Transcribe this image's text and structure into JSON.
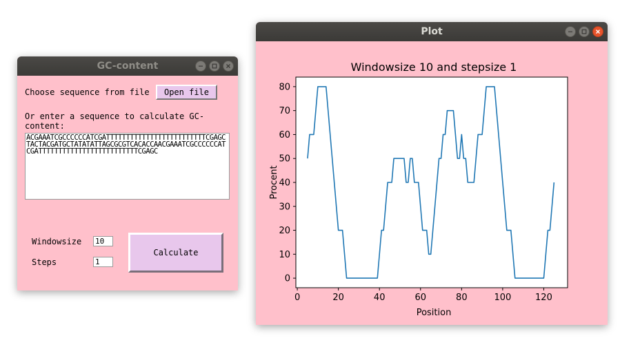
{
  "gc_window": {
    "title": "GC-content",
    "choose_label": "Choose sequence from file",
    "open_button": "Open file",
    "enter_label": "Or enter a sequence to calculate GC-content:",
    "sequence": "ACGAAATCGCCCCCCATCGATTTTTTTTTTTTTTTTTTTTTTTTTCGAGCTACTACGATGCTATATATTAGCGCGTCACACCAACGAAATCGCCCCCCATCGATTTTTTTTTTTTTTTTTTTTTTTTTCGAGC",
    "windowsize_label": "Windowsize",
    "windowsize_value": "10",
    "steps_label": "Steps",
    "steps_value": "1",
    "calculate_button": "Calculate"
  },
  "plot_window": {
    "title": "Plot"
  },
  "colors": {
    "pink_bg": "#ffc0cb",
    "button_bg": "#e8c7ec",
    "line": "#1f77b4"
  },
  "chart_data": {
    "type": "line",
    "title": "Windowsize 10 and stepsize 1",
    "xlabel": "Position",
    "ylabel": "Procent",
    "xlim": [
      -0.7,
      131.6
    ],
    "ylim": [
      -4,
      84
    ],
    "xticks": [
      0,
      20,
      40,
      60,
      80,
      100,
      120
    ],
    "yticks": [
      0,
      10,
      20,
      30,
      40,
      50,
      60,
      70,
      80
    ],
    "grid": false,
    "series": [
      {
        "x": [
          5,
          6,
          7,
          8,
          9,
          10,
          11,
          12,
          13,
          14,
          15,
          16,
          17,
          18,
          19,
          20,
          21,
          22,
          23,
          24,
          25,
          26,
          27,
          28,
          29,
          30,
          31,
          32,
          33,
          34,
          35,
          36,
          37,
          38,
          39,
          40,
          41,
          42,
          43,
          44,
          45,
          46,
          47,
          48,
          49,
          50,
          51,
          52,
          53,
          54,
          55,
          56,
          57,
          58,
          59,
          60,
          61,
          62,
          63,
          64,
          65,
          66,
          67,
          68,
          69,
          70,
          71,
          72,
          73,
          74,
          75,
          76,
          77,
          78,
          79,
          80,
          81,
          82,
          83,
          84,
          85,
          86,
          87,
          88,
          89,
          90,
          91,
          92,
          93,
          94,
          95,
          96,
          97,
          98,
          99,
          100,
          101,
          102,
          103,
          104,
          105,
          106,
          107,
          108,
          109,
          110,
          111,
          112,
          113,
          114,
          115,
          116,
          117,
          118,
          119,
          120,
          121,
          122,
          123,
          124,
          125
        ],
        "y": [
          50,
          60,
          60,
          60,
          70,
          80,
          80,
          80,
          80,
          80,
          70,
          60,
          50,
          40,
          30,
          20,
          20,
          20,
          10,
          0,
          0,
          0,
          0,
          0,
          0,
          0,
          0,
          0,
          0,
          0,
          0,
          0,
          0,
          0,
          0,
          10,
          20,
          20,
          30,
          40,
          40,
          40,
          50,
          50,
          50,
          50,
          50,
          50,
          40,
          40,
          50,
          50,
          40,
          40,
          40,
          30,
          20,
          20,
          20,
          10,
          10,
          20,
          30,
          40,
          50,
          50,
          60,
          60,
          70,
          70,
          70,
          70,
          60,
          50,
          50,
          60,
          50,
          50,
          40,
          40,
          40,
          40,
          50,
          60,
          60,
          60,
          70,
          80,
          80,
          80,
          80,
          80,
          70,
          60,
          50,
          40,
          30,
          20,
          20,
          20,
          10,
          0,
          0,
          0,
          0,
          0,
          0,
          0,
          0,
          0,
          0,
          0,
          0,
          0,
          0,
          0,
          10,
          20,
          20,
          30,
          40
        ]
      }
    ]
  }
}
